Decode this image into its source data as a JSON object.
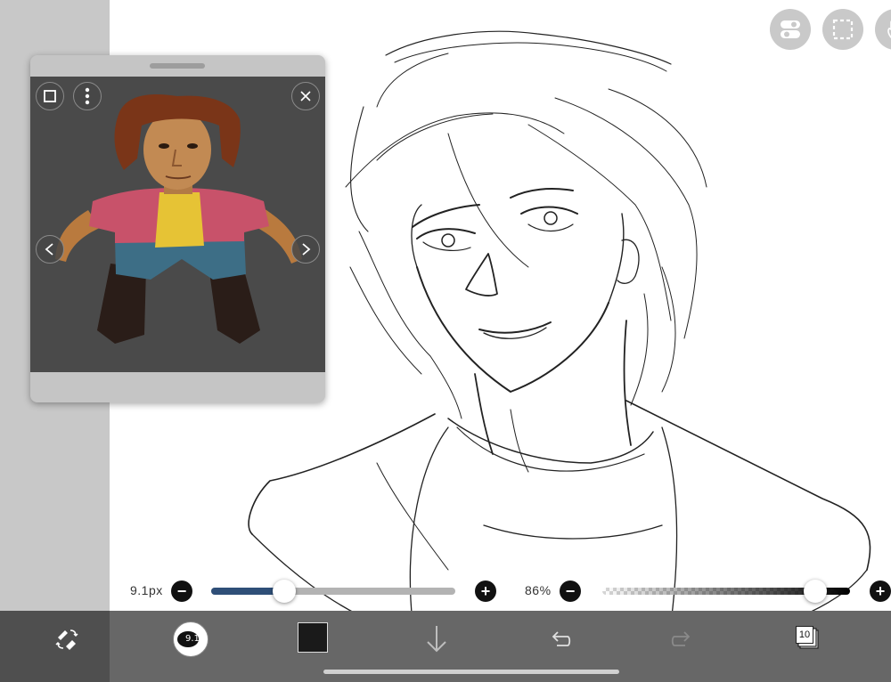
{
  "reference": {
    "title": "",
    "close_icon": "close-icon",
    "frame_icon": "square-frame-icon",
    "menu_icon": "vertical-dots-icon",
    "prev_icon": "chevron-left-icon",
    "next_icon": "chevron-right-icon"
  },
  "top_buttons": {
    "left": "toggle-settings-icon",
    "middle": "selection-icon",
    "right": "hand-icon"
  },
  "brush": {
    "size_label": "9.1px",
    "size_value": 0.3,
    "opacity_label": "86%",
    "opacity_value": 0.86,
    "minus": "−",
    "plus": "+"
  },
  "toolbar": {
    "brush_number": "9.1",
    "layer_count": "10",
    "color": "#1a1a1a"
  },
  "colors": {
    "slider_fill": "#2f4f78",
    "toolbar_bg": "#676767",
    "left_strip": "#c8c8c8"
  }
}
